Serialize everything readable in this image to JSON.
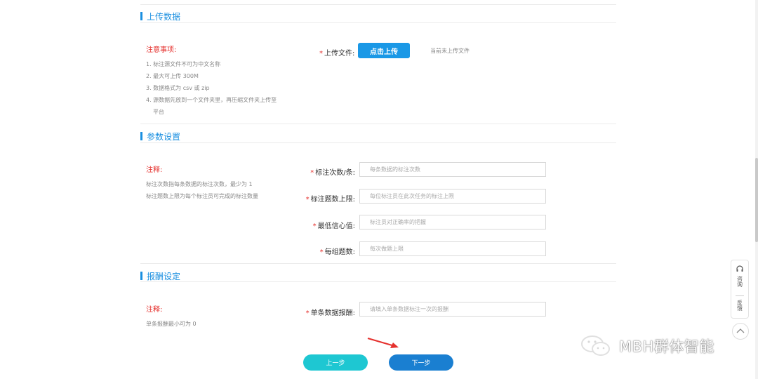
{
  "sections": {
    "upload": {
      "title": "上传数据",
      "note_title": "注意事项:",
      "notes": [
        "1. 标注源文件不可为中文名称",
        "2. 最大可上传 300M",
        "3. 数据格式为 csv 或 zip",
        "4. 源数据先放到一个文件夹里，再压缩文件夹上传至",
        "平台"
      ],
      "field_label": "上传文件:",
      "upload_button": "点击上传",
      "no_file_text": "当前未上传文件"
    },
    "params": {
      "title": "参数设置",
      "note_title": "注释:",
      "notes": [
        "标注次数指每条数据的标注次数，最少为 1",
        "标注题数上限为每个标注员可完成的标注数量"
      ],
      "fields": [
        {
          "label": "标注次数/条:",
          "placeholder": "每条数据的标注次数"
        },
        {
          "label": "标注题数上限:",
          "placeholder": "每位标注员在此次任务的标注上限"
        },
        {
          "label": "最低信心值:",
          "placeholder": "标注员对正确率的把握"
        },
        {
          "label": "每组题数:",
          "placeholder": "每次做题上限"
        }
      ]
    },
    "reward": {
      "title": "报酬设定",
      "note_title": "注释:",
      "notes": [
        "单条报酬最小可为 0"
      ],
      "field": {
        "label": "单条数据报酬:",
        "placeholder": "请填入单条数据标注一次的报酬"
      }
    }
  },
  "buttons": {
    "prev": "上一步",
    "next": "下一步"
  },
  "side_panel": {
    "consult": "咨询",
    "feedback": "反馈"
  },
  "watermark": "MBH群体智能",
  "required_mark": "*",
  "colors": {
    "accent": "#1a8fe0",
    "required": "#e5302d",
    "prev_button": "#1ec7d2",
    "next_button": "#1a7fd1"
  },
  "icons": {
    "consult": "headset-icon",
    "back_to_top": "chevron-up-icon",
    "watermark": "wechat-icon",
    "pointer": "red-arrow-icon"
  }
}
